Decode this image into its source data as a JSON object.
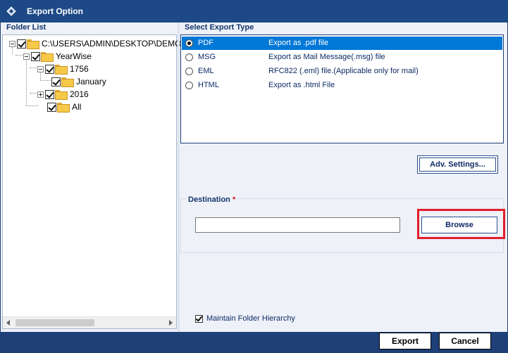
{
  "window": {
    "title": "Export Option"
  },
  "folder_list": {
    "label": "Folder List",
    "nodes": {
      "root": "C:\\USERS\\ADMIN\\DESKTOP\\DEMO",
      "yearwise": "YearWise",
      "y1756": "1756",
      "january": "January",
      "y2016": "2016",
      "all": "All"
    }
  },
  "export_type": {
    "label": "Select Export Type",
    "options": [
      {
        "name": "PDF",
        "desc": "Export as .pdf file",
        "selected": true
      },
      {
        "name": "MSG",
        "desc": "Export as Mail Message(.msg) file",
        "selected": false
      },
      {
        "name": "EML",
        "desc": "RFC822 (.eml) file.(Applicable only for mail)",
        "selected": false
      },
      {
        "name": "HTML",
        "desc": "Export as .html File",
        "selected": false
      }
    ]
  },
  "adv_settings_label": "Adv. Settings...",
  "destination": {
    "label": "Destination",
    "required_mark": "*",
    "value": "",
    "browse_label": "Browse"
  },
  "maintain_hierarchy": {
    "label": "Maintain Folder Hierarchy",
    "checked": true
  },
  "footer": {
    "export_label": "Export",
    "cancel_label": "Cancel"
  },
  "colors": {
    "title_bar": "#1d4a86",
    "accent": "#0078d7",
    "highlight": "#e21d2b"
  }
}
